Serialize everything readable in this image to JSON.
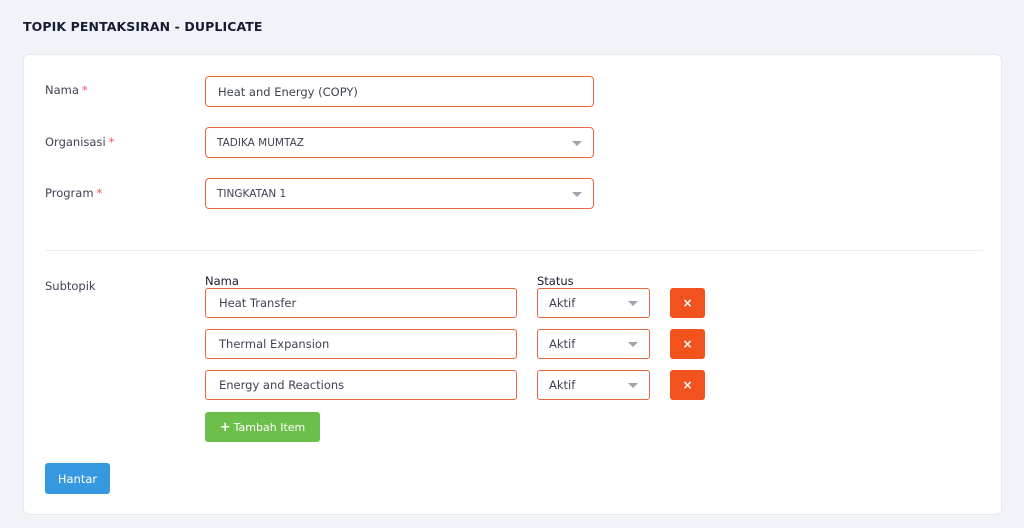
{
  "page": {
    "title": "TOPIK PENTAKSIRAN - DUPLICATE"
  },
  "form": {
    "required_mark": "*",
    "nama": {
      "label": "Nama",
      "value": "Heat and Energy (COPY)"
    },
    "organisasi": {
      "label": "Organisasi",
      "value": "TADIKA MUMTAZ"
    },
    "program": {
      "label": "Program",
      "value": "TINGKATAN 1"
    }
  },
  "subtopik": {
    "label": "Subtopik",
    "col_nama": "Nama",
    "col_status": "Status",
    "items": [
      {
        "name": "Heat Transfer",
        "status": "Aktif",
        "delete_label": "×"
      },
      {
        "name": "Thermal Expansion",
        "status": "Aktif",
        "delete_label": "×"
      },
      {
        "name": "Energy and Reactions",
        "status": "Aktif",
        "delete_label": "×"
      }
    ],
    "add_icon": "+",
    "add_label": "Tambah Item"
  },
  "actions": {
    "submit_label": "Hantar"
  },
  "colors": {
    "input_border": "#e8663f",
    "delete": "#f2521e",
    "add": "#6cbf4a",
    "submit": "#3699e0",
    "required": "#f64e60"
  }
}
